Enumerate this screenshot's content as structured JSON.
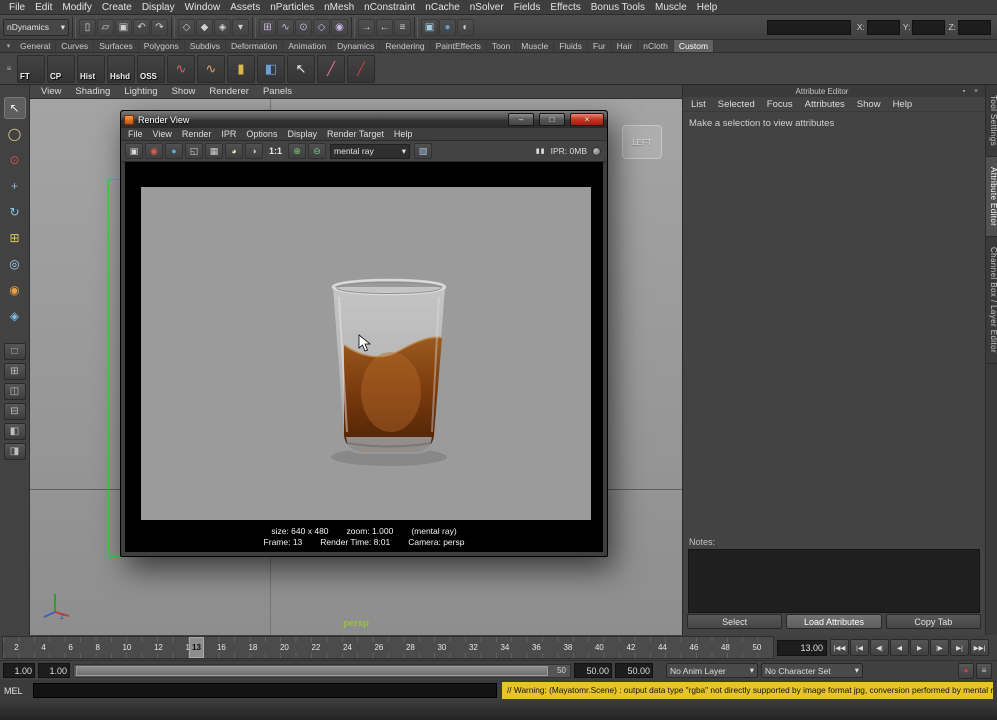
{
  "ui": {
    "chevron_down": "▾"
  },
  "menubar": {
    "items": [
      "File",
      "Edit",
      "Modify",
      "Create",
      "Display",
      "Window",
      "Assets",
      "nParticles",
      "nMesh",
      "nConstraint",
      "nCache",
      "nSolver",
      "Fields",
      "Effects",
      "Bonus Tools",
      "Muscle",
      "Help"
    ]
  },
  "statusline": {
    "menuset": "nDynamics",
    "file_icons": [
      {
        "name": "new-scene-icon",
        "glyph": "▯",
        "color": "#d0d0d0"
      },
      {
        "name": "open-scene-icon",
        "glyph": "▱",
        "color": "#d0d0d0"
      },
      {
        "name": "save-scene-icon",
        "glyph": "▣",
        "color": "#d0d0d0"
      },
      {
        "name": "undo-icon",
        "glyph": "↶",
        "color": "#d0d0d0"
      },
      {
        "name": "redo-icon",
        "glyph": "↷",
        "color": "#d0d0d0"
      }
    ],
    "selection_icons": [
      {
        "name": "select-hierarchy-icon",
        "glyph": "◇",
        "color": "#cfcfcf"
      },
      {
        "name": "select-object-icon",
        "glyph": "◆",
        "color": "#cfcfcf"
      },
      {
        "name": "select-component-icon",
        "glyph": "◈",
        "color": "#cfcfcf"
      },
      {
        "name": "selection-mask-dropdown-icon",
        "glyph": "▾",
        "color": "#cfcfcf"
      }
    ],
    "snap_icons": [
      {
        "name": "snap-to-grid-icon",
        "glyph": "⊞",
        "color": "#c8b8e8"
      },
      {
        "name": "snap-to-curve-icon",
        "glyph": "∿",
        "color": "#c8b8e8"
      },
      {
        "name": "snap-to-point-icon",
        "glyph": "⊙",
        "color": "#c8b8e8"
      },
      {
        "name": "snap-to-plane-icon",
        "glyph": "◇",
        "color": "#c8b8e8"
      },
      {
        "name": "make-live-icon",
        "glyph": "◉",
        "color": "#c8b8e8"
      }
    ],
    "history_icons": [
      {
        "name": "input-connections-icon",
        "glyph": "→",
        "color": "#cfcfcf"
      },
      {
        "name": "output-connections-icon",
        "glyph": "←",
        "color": "#cfcfcf"
      },
      {
        "name": "construction-history-icon",
        "glyph": "≡",
        "color": "#cfcfcf"
      }
    ],
    "render_icons": [
      {
        "name": "render-current-frame-icon",
        "glyph": "▣",
        "color": "#9fd0e8"
      },
      {
        "name": "ipr-render-icon",
        "glyph": "●",
        "color": "#5aa0d0"
      },
      {
        "name": "render-settings-icon",
        "glyph": "◐",
        "color": "#d0d0d0"
      }
    ],
    "coord_fields": [
      {
        "label": "X:"
      },
      {
        "label": "Y:"
      },
      {
        "label": "Z:"
      }
    ]
  },
  "shelf": {
    "tabs": [
      {
        "label": "General"
      },
      {
        "label": "Curves"
      },
      {
        "label": "Surfaces"
      },
      {
        "label": "Polygons"
      },
      {
        "label": "Subdivs"
      },
      {
        "label": "Deformation"
      },
      {
        "label": "Animation"
      },
      {
        "label": "Dynamics"
      },
      {
        "label": "Rendering"
      },
      {
        "label": "PaintEffects"
      },
      {
        "label": "Toon"
      },
      {
        "label": "Muscle"
      },
      {
        "label": "Fluids"
      },
      {
        "label": "Fur"
      },
      {
        "label": "Hair"
      },
      {
        "label": "nCloth"
      },
      {
        "label": "Custom",
        "active": true
      }
    ],
    "items": [
      {
        "name": "shelf-ft-button",
        "label": "FT"
      },
      {
        "name": "shelf-cp-button",
        "label": "CP"
      },
      {
        "name": "shelf-hist-button",
        "label": "Hist"
      },
      {
        "name": "shelf-hshd-button",
        "label": "Hshd"
      },
      {
        "name": "shelf-oss-button",
        "label": "OSS"
      },
      {
        "name": "cv-curve-tool-icon",
        "glyph": "∿",
        "color": "#e06060"
      },
      {
        "name": "ep-curve-tool-icon",
        "glyph": "∿",
        "color": "#e0a060"
      },
      {
        "name": "bevel-plus-icon",
        "glyph": "▮",
        "color": "#d8b84a"
      },
      {
        "name": "polygon-cube-icon",
        "glyph": "◧",
        "color": "#6a9fd8"
      },
      {
        "name": "select-arrow-icon",
        "glyph": "↖",
        "color": "#ececec"
      },
      {
        "name": "paint-effects-brush-icon",
        "glyph": "╱",
        "color": "#e070a0"
      },
      {
        "name": "paint-brush-icon",
        "glyph": "╱",
        "color": "#d04040"
      }
    ]
  },
  "toolbox": {
    "tools": [
      {
        "name": "select-tool",
        "glyph": "↖",
        "active": true,
        "color": "#f0f0f0"
      },
      {
        "name": "lasso-tool",
        "glyph": "◯",
        "color": "#e0d890"
      },
      {
        "name": "paint-selection-tool",
        "glyph": "⊙",
        "color": "#d05050"
      },
      {
        "name": "move-tool",
        "glyph": "+",
        "color": "#8ab4e8"
      },
      {
        "name": "rotate-tool",
        "glyph": "↻",
        "color": "#88c8e8"
      },
      {
        "name": "scale-tool",
        "glyph": "⊞",
        "color": "#d8c860"
      },
      {
        "name": "universal-manipulator-tool",
        "glyph": "◎",
        "color": "#a0d0f0"
      },
      {
        "name": "soft-modification-tool",
        "glyph": "◉",
        "color": "#e8a040"
      },
      {
        "name": "show-manipulator-tool",
        "glyph": "◈",
        "color": "#80c0f0"
      }
    ],
    "layouts": [
      {
        "name": "single-pane-layout-button",
        "glyph": "□"
      },
      {
        "name": "four-pane-layout-button",
        "glyph": "⊞"
      },
      {
        "name": "two-pane-side-layout-button",
        "glyph": "◫"
      },
      {
        "name": "two-pane-stacked-layout-button",
        "glyph": "⊟"
      },
      {
        "name": "three-pane-left-layout-button",
        "glyph": "◧"
      },
      {
        "name": "three-pane-right-layout-button",
        "glyph": "◨"
      }
    ]
  },
  "viewport": {
    "menus": [
      "View",
      "Shading",
      "Lighting",
      "Show",
      "Renderer",
      "Panels"
    ],
    "camera_label": "persp",
    "side_view_label": "LEFT",
    "axis_z_label": "z"
  },
  "render_view": {
    "title": "Render View",
    "window": {
      "minimize_glyph": "–",
      "maximize_glyph": "□",
      "close_glyph": "×"
    },
    "menus": [
      "File",
      "View",
      "Render",
      "IPR",
      "Options",
      "Display",
      "Render Target",
      "Help"
    ],
    "toolbar_icons_left": [
      {
        "name": "render-current-frame-icon",
        "glyph": "▣",
        "color": "#d8d8d8"
      },
      {
        "name": "redo-previous-render-icon",
        "glyph": "◉",
        "color": "#d86050"
      },
      {
        "name": "ipr-render-icon",
        "glyph": "●",
        "color": "#5aa8d8"
      },
      {
        "name": "render-region-icon",
        "glyph": "◱",
        "color": "#d0d0d0"
      },
      {
        "name": "snapshot-icon",
        "glyph": "▦",
        "color": "#d0d0d0"
      },
      {
        "name": "rgb-channels-icon",
        "glyph": "◕",
        "color": "#e8e0c0"
      },
      {
        "name": "alpha-channels-icon",
        "glyph": "◑",
        "color": "#c4c4c4"
      }
    ],
    "zoom_label": "1:1",
    "toolbar_icons_keep": [
      {
        "name": "keep-image-icon",
        "glyph": "⊕",
        "color": "#78c878"
      },
      {
        "name": "remove-image-icon",
        "glyph": "⊖",
        "color": "#78c878"
      }
    ],
    "renderer": "mental ray",
    "toolbar_icons_right": [
      {
        "name": "render-settings-bucket-icon",
        "glyph": "▧",
        "color": "#9fc0e0"
      }
    ],
    "pause_glyph": "▮▮",
    "ipr_memory": "IPR: 0MB",
    "status": {
      "size": "size: 640 x 480",
      "zoom": "zoom: 1.000",
      "renderer": "(mental ray)",
      "frame": "Frame: 13",
      "render_time": "Render Time: 8:01",
      "camera": "Camera: persp"
    }
  },
  "attribute_editor": {
    "title": "Attribute Editor",
    "header_icons": [
      {
        "name": "attribute-editor-pin-icon",
        "glyph": "▪"
      },
      {
        "name": "attribute-editor-close-icon",
        "glyph": "×"
      }
    ],
    "menus": [
      "List",
      "Selected",
      "Focus",
      "Attributes",
      "Show",
      "Help"
    ],
    "message": "Make a selection to view attributes",
    "notes_label": "Notes:",
    "buttons": [
      {
        "name": "select-button",
        "label": "Select"
      },
      {
        "name": "load-attributes-button",
        "label": "Load Attributes",
        "active": true
      },
      {
        "name": "copy-tab-button",
        "label": "Copy Tab"
      }
    ]
  },
  "side_tabs": [
    {
      "label": "Tool Settings"
    },
    {
      "label": "Attribute Editor",
      "active": true
    },
    {
      "label": "Channel Box / Layer Editor"
    }
  ],
  "timeline": {
    "ticks": [
      "2",
      "4",
      "6",
      "8",
      "10",
      "12",
      "14",
      "16",
      "18",
      "20",
      "22",
      "24",
      "26",
      "28",
      "30",
      "32",
      "34",
      "36",
      "38",
      "40",
      "42",
      "44",
      "46",
      "48",
      "50"
    ],
    "current_frame": "13",
    "frame_field": "13.00",
    "transport": [
      {
        "name": "go-to-start-button",
        "glyph": "|◀◀"
      },
      {
        "name": "step-back-frame-button",
        "glyph": "|◀"
      },
      {
        "name": "step-back-key-button",
        "glyph": "◀|"
      },
      {
        "name": "play-backwards-button",
        "glyph": "◀"
      },
      {
        "name": "play-forwards-button",
        "glyph": "▶"
      },
      {
        "name": "step-forward-key-button",
        "glyph": "|▶"
      },
      {
        "name": "step-forward-frame-button",
        "glyph": "▶|"
      },
      {
        "name": "go-to-end-button",
        "glyph": "▶▶|"
      }
    ]
  },
  "range_slider": {
    "start_min": "1.00",
    "start_current": "1.00",
    "end_label": "50",
    "end_current": "50.00",
    "end_max": "50.00",
    "anim_layer": "No Anim Layer",
    "character_set": "No Character Set",
    "buttons": [
      {
        "name": "auto-keyframe-button",
        "glyph": "●",
        "color": "#d04040"
      },
      {
        "name": "animation-preferences-button",
        "glyph": "≡",
        "color": "#d0d0d0"
      }
    ]
  },
  "command_line": {
    "label": "MEL",
    "warning": "// Warning: (Mayatomr.Scene) : output data type \"rgba\" not directly supported by image format jpg, conversion performed by mental ray"
  }
}
